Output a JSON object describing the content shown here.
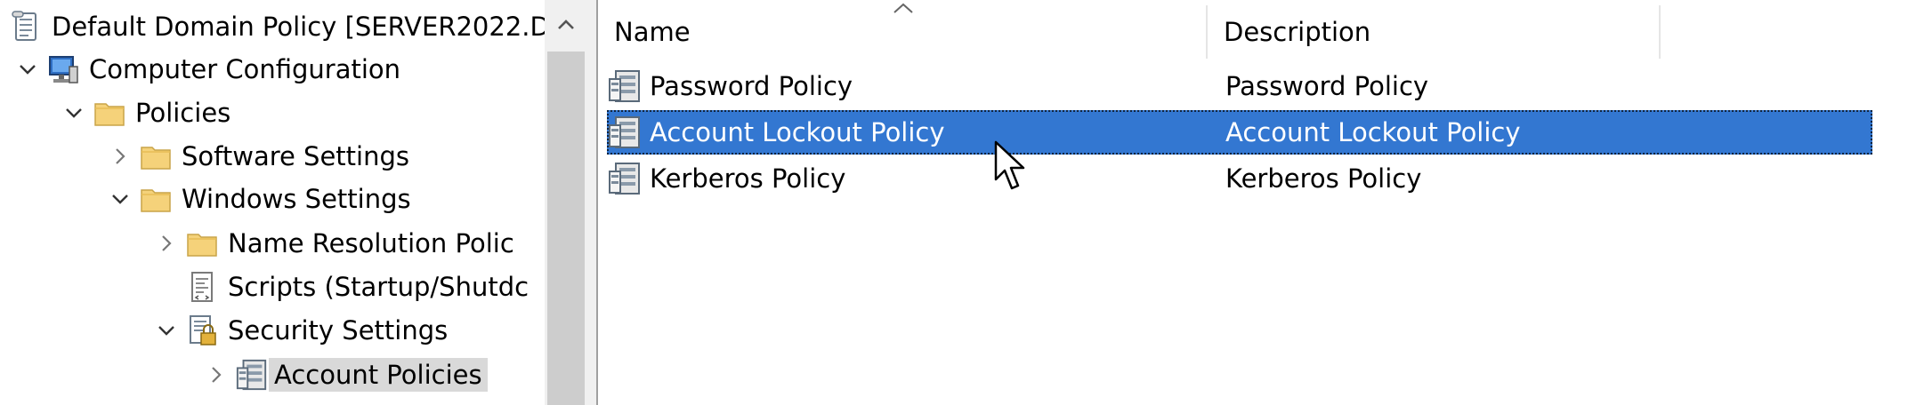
{
  "tree": {
    "items": [
      {
        "label": "Default Domain Policy [SERVER2022.D",
        "icon": "policy-scroll-icon",
        "chevron": "none"
      },
      {
        "label": "Computer Configuration",
        "icon": "computer-icon",
        "chevron": "expanded"
      },
      {
        "label": "Policies",
        "icon": "folder-icon",
        "chevron": "expanded"
      },
      {
        "label": "Software Settings",
        "icon": "folder-icon",
        "chevron": "collapsed"
      },
      {
        "label": "Windows Settings",
        "icon": "folder-icon",
        "chevron": "expanded"
      },
      {
        "label": "Name Resolution Polic",
        "icon": "folder-icon",
        "chevron": "collapsed"
      },
      {
        "label": "Scripts (Startup/Shutdc",
        "icon": "script-icon",
        "chevron": "none"
      },
      {
        "label": "Security Settings",
        "icon": "security-settings-icon",
        "chevron": "expanded"
      },
      {
        "label": "Account Policies",
        "icon": "policy-server-icon",
        "chevron": "collapsed",
        "selected": true
      }
    ]
  },
  "list": {
    "columns": {
      "name": "Name",
      "description": "Description"
    },
    "rows": [
      {
        "name": "Password Policy",
        "description": "Password Policy",
        "icon": "policy-server-icon"
      },
      {
        "name": "Account Lockout Policy",
        "description": "Account Lockout Policy",
        "icon": "policy-server-icon",
        "selected": true
      },
      {
        "name": "Kerberos Policy",
        "description": "Kerberos Policy",
        "icon": "policy-server-icon"
      }
    ]
  },
  "colors": {
    "selection": "#3377d1",
    "tree_selection": "#d9d9d9",
    "folder": "#f5d27a"
  }
}
